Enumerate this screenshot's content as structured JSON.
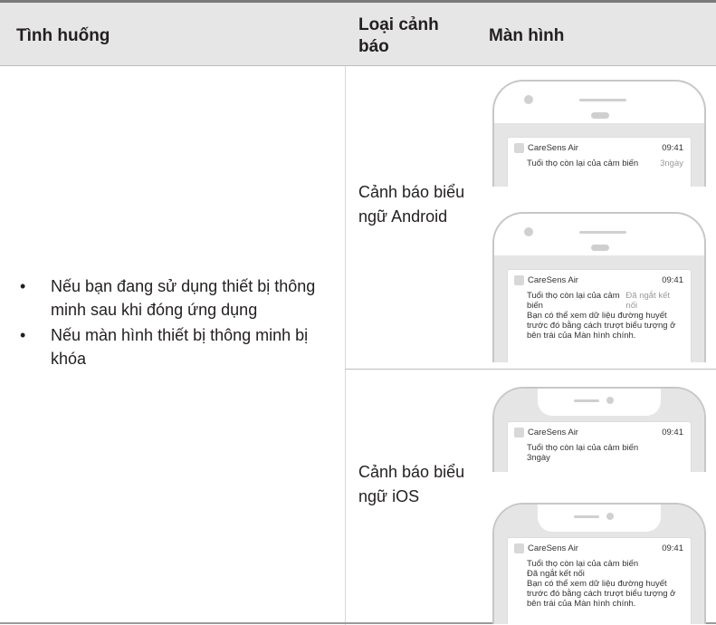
{
  "header": {
    "col1": "Tình huống",
    "col2": "Loại cảnh báo",
    "col3": "Màn hình"
  },
  "situations": [
    "Nếu bạn đang sử dụng thiết bị thông minh sau khi đóng ứng dụng",
    "Nếu màn hình thiết bị thông minh bị khóa"
  ],
  "bullet_char": "•",
  "alert_types": {
    "android": "Cảnh báo biểu ngữ Android",
    "ios": "Cảnh báo biểu ngữ iOS"
  },
  "notifications": {
    "android_1": {
      "app": "CareSens Air",
      "time": "09:41",
      "message": "Tuổi thọ còn lại của cảm biến",
      "extra": "3ngày"
    },
    "android_2": {
      "app": "CareSens Air",
      "time": "09:41",
      "message": "Tuổi thọ còn lại của cảm biến",
      "extra": "Đã ngắt kết nối",
      "detail": "Bạn có thể xem dữ liệu đường huyết trước đó bằng cách trượt biểu tượng ở bên trái của Màn hình chính."
    },
    "ios_1": {
      "app": "CareSens Air",
      "time": "09:41",
      "message": "Tuổi thọ còn lại của cảm biến",
      "extra": "3ngày"
    },
    "ios_2": {
      "app": "CareSens Air",
      "time": "09:41",
      "message": "Tuổi thọ còn lại của cảm biến",
      "extra": "Đã ngắt kết nối",
      "detail": "Bạn có thể xem dữ liệu đường huyết trước đó bằng cách trượt biểu tượng ở bên trái của Màn hình chính."
    }
  },
  "colors": {
    "header_bg": "#e6e6e6",
    "screen_bg": "#e5e5e5",
    "text": "#231f20"
  }
}
